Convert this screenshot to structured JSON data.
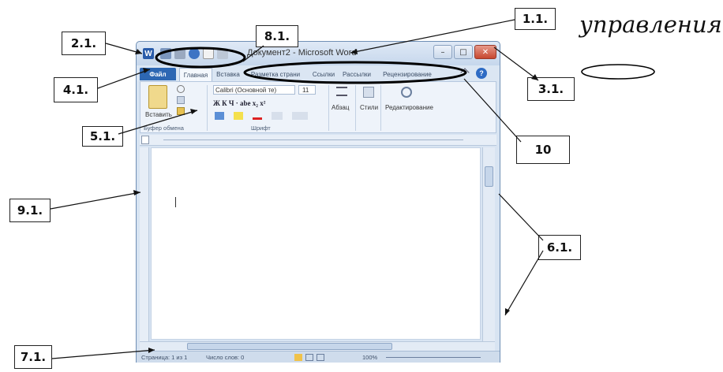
{
  "heading": "управления.",
  "callouts": {
    "c_1_1": "1.1.",
    "c_2_1": "2.1.",
    "c_3_1": "3.1.",
    "c_4_1": "4.1.",
    "c_5_1": "5.1.",
    "c_6_1": "6.1.",
    "c_7_1": "7.1.",
    "c_8_1": "8.1.",
    "c_9_1": "9.1.",
    "c_10": "10"
  },
  "window": {
    "title": "Документ2 - Microsoft Word",
    "app_icon": "W",
    "controls": {
      "minimize": "–",
      "maximize": "□",
      "close": "✕"
    }
  },
  "tabs": [
    "Файл",
    "Главная",
    "Вставка",
    "Разметка страни",
    "Ссылки",
    "Рассылки",
    "Рецензирование"
  ],
  "ribbon": {
    "paste_label": "Вставить",
    "clipboard_group": "Буфер обмена",
    "font_name": "Calibri (Основной те)",
    "font_size": "11",
    "format_row": "Ж К Ч · abe x₂ x²",
    "font_group": "Шрифт",
    "paragraph": "Абзац",
    "styles": "Стили",
    "editing": "Редактирование"
  },
  "status": {
    "page": "Страница: 1 из 1",
    "words": "Число слов: 0",
    "zoom": "100%"
  },
  "icons": {
    "help": "help-icon",
    "minimize": "minimize-icon",
    "maximize": "maximize-icon",
    "close": "close-icon"
  }
}
